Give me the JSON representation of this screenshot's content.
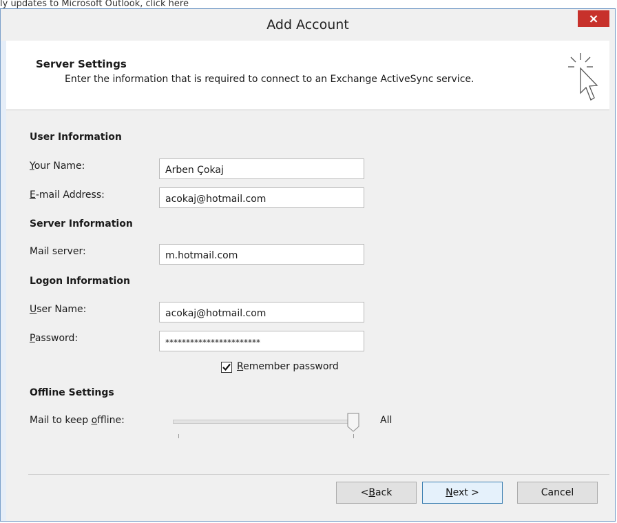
{
  "top_text": "ly updates to Microsoft Outlook, click here",
  "window": {
    "title": "Add Account",
    "close_glyph": "×"
  },
  "header": {
    "title": "Server Settings",
    "description": "Enter the information that is required to connect to an Exchange ActiveSync service."
  },
  "user_info": {
    "heading": "User Information",
    "your_name": {
      "label_u": "Y",
      "label_rest": "our Name:",
      "value": "Arben Çokaj"
    },
    "email": {
      "label_u": "E",
      "label_rest": "-mail Address:",
      "value": "acokaj@hotmail.com"
    }
  },
  "server_info": {
    "heading": "Server Information",
    "mail_server": {
      "label": "Mail server:",
      "value": "m.hotmail.com"
    }
  },
  "logon_info": {
    "heading": "Logon Information",
    "user_name": {
      "label_u": "U",
      "label_rest": "ser Name:",
      "value": "acokaj@hotmail.com"
    },
    "password": {
      "label_u": "P",
      "label_rest": "assword:",
      "value": "***********************"
    },
    "remember": {
      "label_u": "R",
      "label_rest": "emember password",
      "checked": true
    }
  },
  "offline": {
    "heading": "Offline Settings",
    "label_pre": "Mail to keep ",
    "label_u": "o",
    "label_rest": "ffline:",
    "value": "All",
    "level": 1.0
  },
  "buttons": {
    "back_pre": "< ",
    "back_u": "B",
    "back_rest": "ack",
    "next_u": "N",
    "next_rest": "ext >",
    "cancel": "Cancel"
  }
}
